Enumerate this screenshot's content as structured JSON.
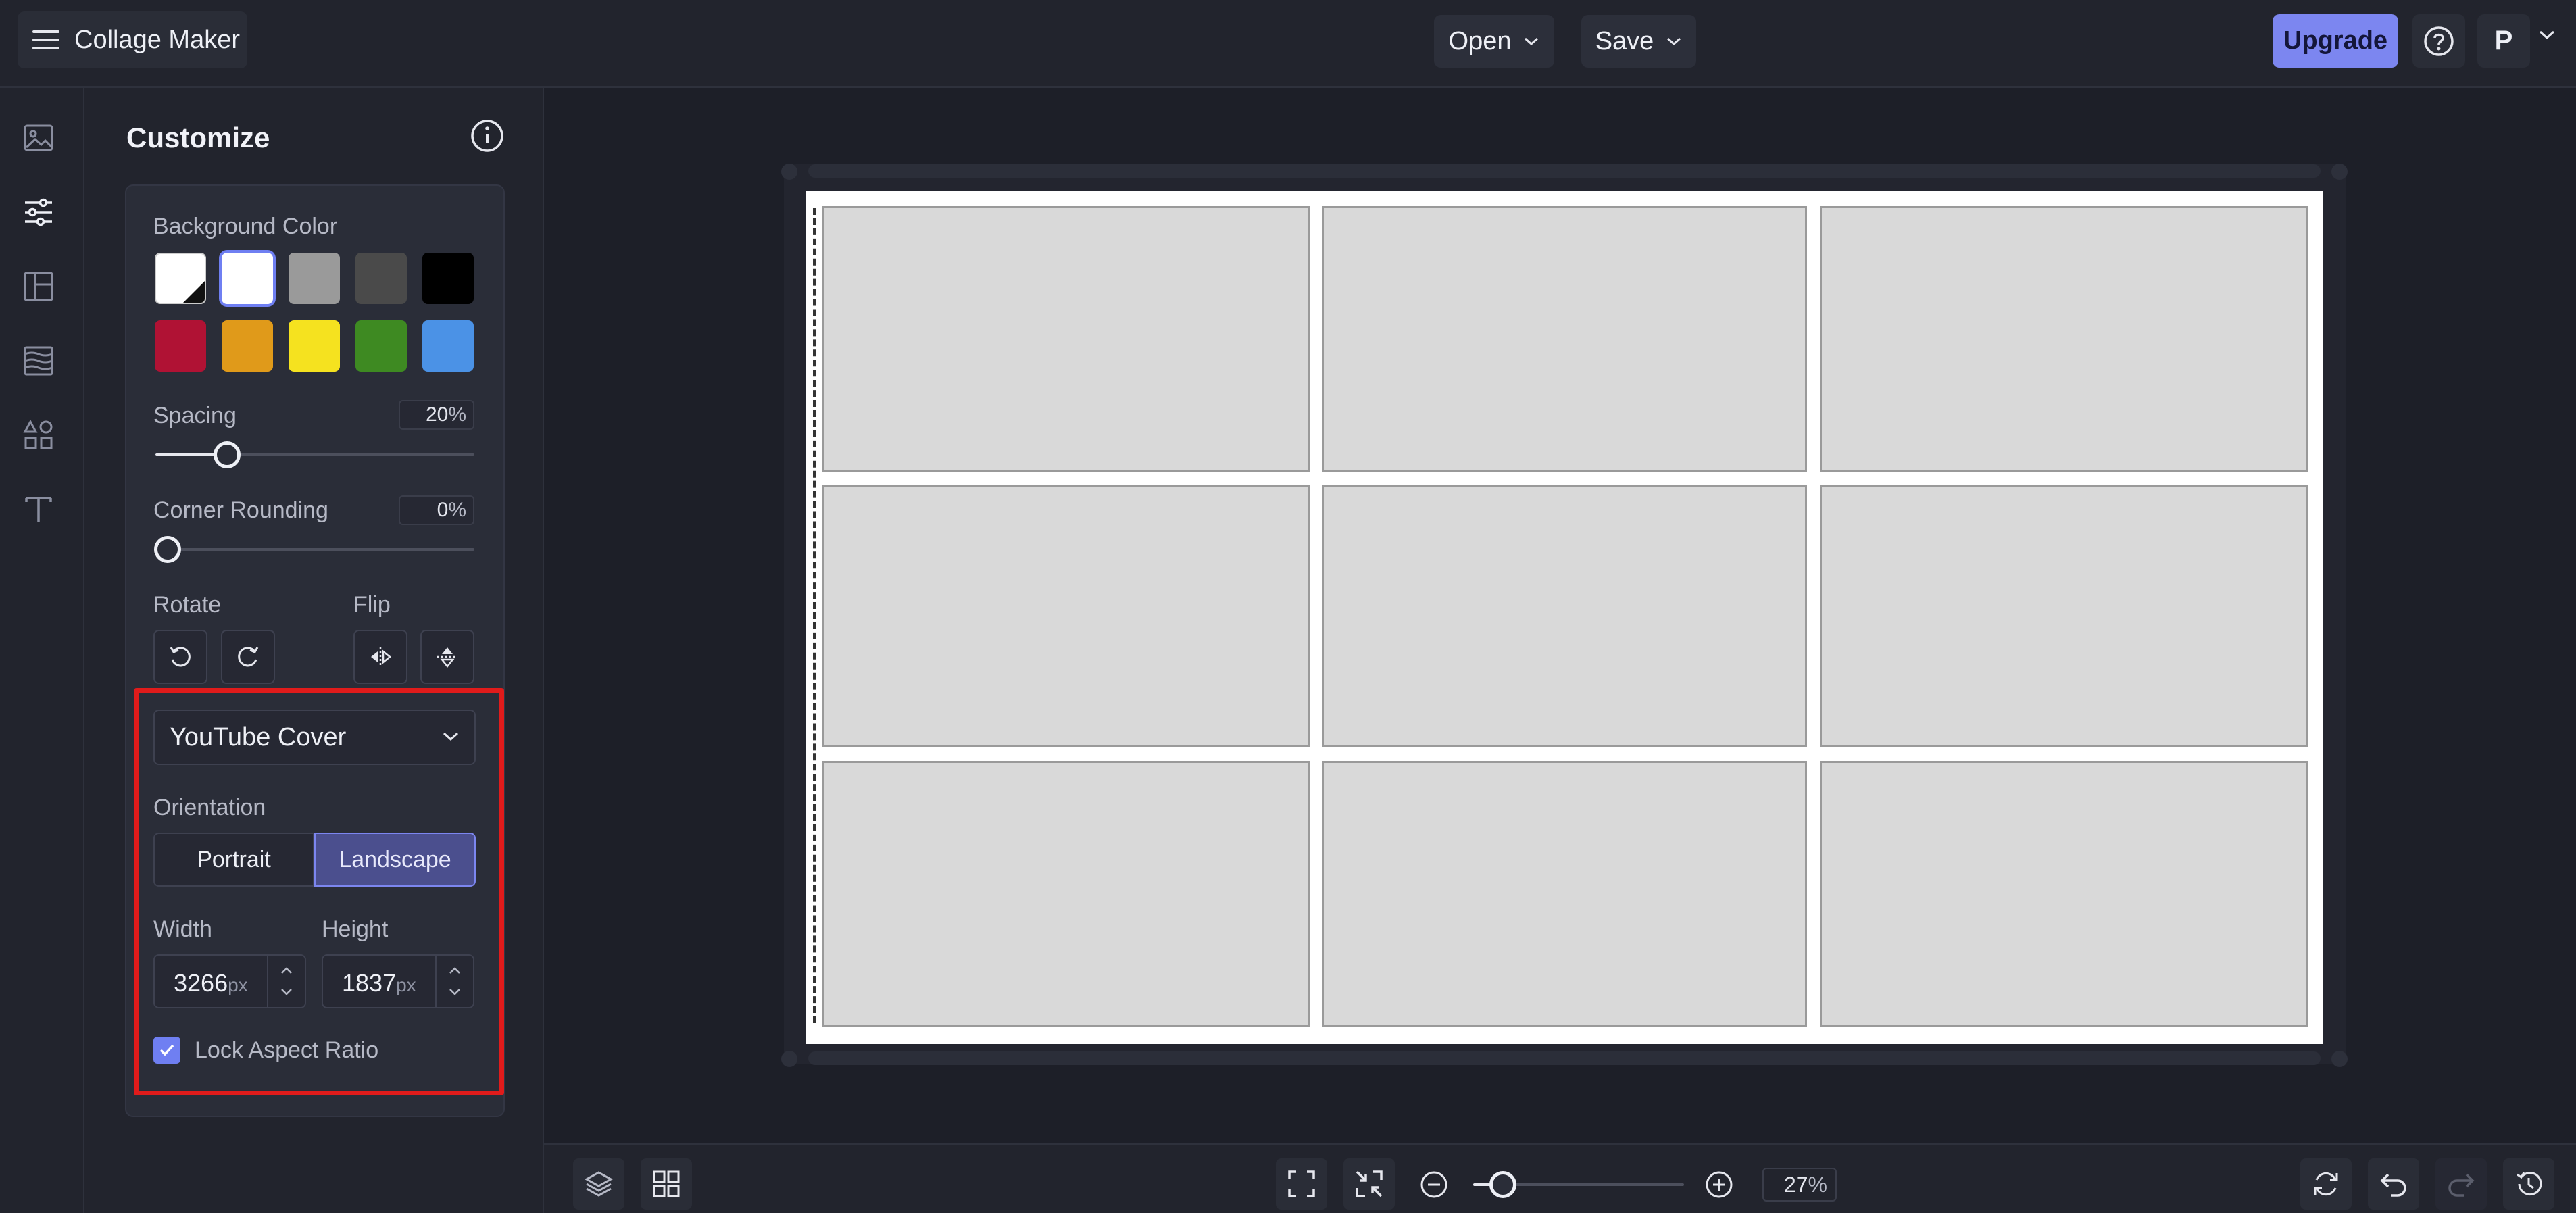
{
  "app": {
    "title": "Collage Maker"
  },
  "topbar": {
    "open_label": "Open",
    "save_label": "Save",
    "upgrade_label": "Upgrade",
    "avatar_initial": "P"
  },
  "rail": {
    "items": [
      "image-icon",
      "sliders-icon",
      "layout-icon",
      "texture-icon",
      "shapes-icon",
      "text-icon"
    ],
    "active": "sliders-icon"
  },
  "panel": {
    "title": "Customize",
    "background_color": {
      "label": "Background Color",
      "swatches": [
        "transparent",
        "#ffffff",
        "#9a9a9a",
        "#4a4a4a",
        "#000000",
        "#b01234",
        "#e09a1a",
        "#f5e21f",
        "#3e8a22",
        "#4b92e6"
      ],
      "selected": "#ffffff"
    },
    "spacing": {
      "label": "Spacing",
      "value": "20",
      "unit": "%",
      "level": 0.2
    },
    "corner_rounding": {
      "label": "Corner Rounding",
      "value": "0",
      "unit": "%",
      "level": 0
    },
    "rotate_label": "Rotate",
    "flip_label": "Flip",
    "preset": "YouTube Cover",
    "orientation": {
      "label": "Orientation",
      "portrait": "Portrait",
      "landscape": "Landscape",
      "selected": "Landscape"
    },
    "width": {
      "label": "Width",
      "value": "3266",
      "unit": "px"
    },
    "height": {
      "label": "Height",
      "value": "1837",
      "unit": "px"
    },
    "lock_aspect": {
      "label": "Lock Aspect Ratio",
      "checked": true
    }
  },
  "canvas": {
    "grid_rows": 3,
    "grid_cols": 3,
    "cell_color": "#d9d9d9",
    "background": "#ffffff"
  },
  "bottombar": {
    "zoom_value": "27",
    "zoom_unit": "%",
    "zoom_level": 0.16
  },
  "colors": {
    "accent": "#7c86f0",
    "highlight": "#e01b1b"
  }
}
